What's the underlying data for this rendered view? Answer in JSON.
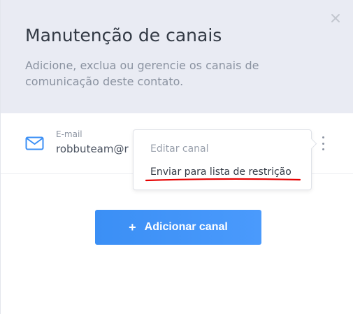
{
  "header": {
    "title": "Manutenção de canais",
    "subtitle": "Adicione, exclua ou gerencie os canais de comunicação deste contato."
  },
  "channel": {
    "type_label": "E-mail",
    "value": "robbuteam@r",
    "icon": "mail-icon"
  },
  "menu": {
    "items": [
      {
        "label": "Editar canal"
      },
      {
        "label": "Enviar para lista de restrição"
      }
    ]
  },
  "add_button": {
    "plus": "+",
    "label": "Adicionar canal"
  },
  "colors": {
    "header_bg": "#e9ebf3",
    "accent": "#3b8ff5",
    "annotation_underline": "#e60000"
  }
}
